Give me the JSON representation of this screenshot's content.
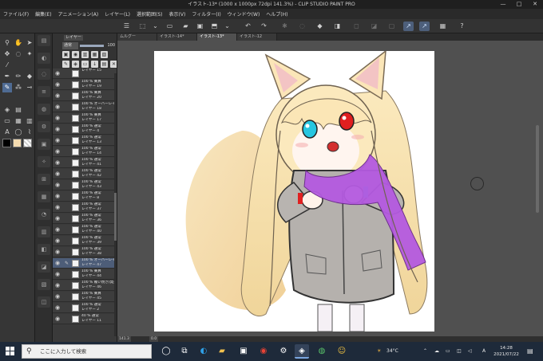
{
  "window": {
    "title": "イラスト-13* (1000 x 1000px 72dpi 141.3%) - CLIP STUDIO PAINT PRO",
    "controls": [
      "—",
      "□",
      "✕"
    ]
  },
  "menu": [
    "ファイル(F)",
    "編集(E)",
    "アニメーション(A)",
    "レイヤー(L)",
    "選択範囲(S)",
    "表示(V)",
    "フィルター(I)",
    "ウィンドウ(W)",
    "ヘルプ(H)"
  ],
  "layer_panel": {
    "tab": "レイヤー",
    "blend_mode": "通常",
    "opacity": "100",
    "opacity_fraction": 1.0,
    "layers": [
      {
        "name": "レイヤー 15",
        "sub": "",
        "selected": false
      },
      {
        "name": "100 % 乗算",
        "sub": "レイヤー 19",
        "selected": false
      },
      {
        "name": "100 % 乗算",
        "sub": "レイヤー 20",
        "selected": false
      },
      {
        "name": "100 % オーバーレイ",
        "sub": "レイヤー 18",
        "selected": false
      },
      {
        "name": "100 % 乗算",
        "sub": "レイヤー 17",
        "selected": false
      },
      {
        "name": "100 % 通常",
        "sub": "レイヤー 4",
        "selected": false
      },
      {
        "name": "100 % 通常",
        "sub": "レイヤー 13",
        "selected": false
      },
      {
        "name": "100 % 通常",
        "sub": "レイヤー 14",
        "selected": false
      },
      {
        "name": "100 % 通常",
        "sub": "レイヤー 41",
        "selected": false
      },
      {
        "name": "100 % 通常",
        "sub": "レイヤー 42",
        "selected": false
      },
      {
        "name": "100 % 通常",
        "sub": "レイヤー 43",
        "selected": false
      },
      {
        "name": "100 % 通常",
        "sub": "レイヤー 8",
        "selected": false
      },
      {
        "name": "100 % 通常",
        "sub": "レイヤー 37",
        "selected": false
      },
      {
        "name": "100 % 通常",
        "sub": "レイヤー 36",
        "selected": false
      },
      {
        "name": "100 % 通常",
        "sub": "レイヤー 40",
        "selected": false
      },
      {
        "name": "100 % 通常",
        "sub": "レイヤー 39",
        "selected": false
      },
      {
        "name": "100 % 通常",
        "sub": "レイヤー 38",
        "selected": false
      },
      {
        "name": "100 % オーバーレイ",
        "sub": "レイヤー 47",
        "selected": true
      },
      {
        "name": "100 % 乗算",
        "sub": "レイヤー 44",
        "selected": false
      },
      {
        "name": "100 % 覆い焼き(発光)",
        "sub": "レイヤー 46",
        "selected": false
      },
      {
        "name": "100 % 乗算",
        "sub": "レイヤー 45",
        "selected": false
      },
      {
        "name": "100 % 通常",
        "sub": "レイヤー 2",
        "selected": false
      },
      {
        "name": "40 % 通常",
        "sub": "レイヤー 11",
        "selected": false
      }
    ]
  },
  "document_tabs": [
    "ムルグー",
    "イラスト-14*",
    "イラスト-13*",
    "イラスト-12"
  ],
  "active_tab_index": 2,
  "status": {
    "zoom": "141.3",
    "angle": "0.0"
  },
  "taskbar": {
    "search_placeholder": "ここに入力して検索",
    "weather": "34°C",
    "ime": "A",
    "time": "14:28",
    "date": "2021/07/22"
  },
  "colors": {
    "main_color": "#000000",
    "sub_color": "#f5dcb0",
    "accent": "#4f6b93",
    "taskbar": "#1e2a3a"
  }
}
